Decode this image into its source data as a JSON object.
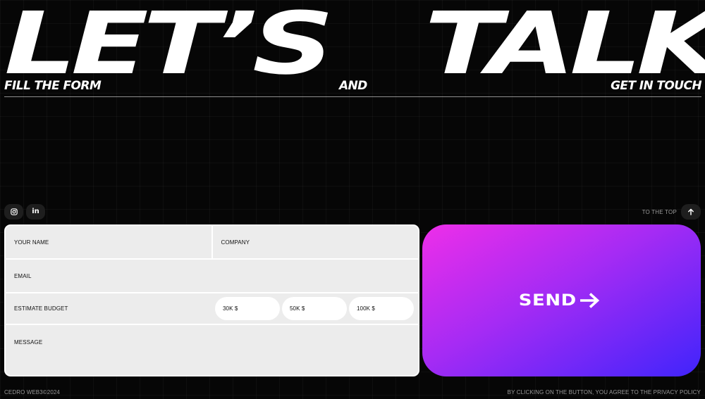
{
  "headline": {
    "left_word": "LET’S",
    "right_word": "TALK"
  },
  "subline": {
    "left": "FILL THE FORM",
    "middle": "AND",
    "right": "GET IN TOUCH"
  },
  "social": {
    "items": [
      {
        "icon": "instagram-icon"
      },
      {
        "icon": "linkedin-icon",
        "glyph": "in"
      }
    ]
  },
  "to_top": {
    "label": "TO THE TOP",
    "icon": "arrow-up-icon"
  },
  "form": {
    "name_label": "YOUR NAME",
    "company_label": "COMPANY",
    "email_label": "EMAIL",
    "budget_label": "ESTIMATE BUDGET",
    "budget_options": [
      "30K $",
      "50K $",
      "100K $"
    ],
    "message_label": "MESSAGE"
  },
  "send": {
    "label": "SEND",
    "icon": "arrow-right-icon",
    "gradient": [
      "#ee2ee9",
      "#a52bf4",
      "#4024fb"
    ]
  },
  "footer": {
    "left": "CEDRO WEB3©2024",
    "right": "BY CLICKING ON THE BUTTON, YOU AGREE TO THE PRIVACY POLICY"
  },
  "colors": {
    "background": "#060606",
    "text": "#ffffff",
    "field_bg": "#ececec",
    "muted": "#9a9a9a"
  }
}
